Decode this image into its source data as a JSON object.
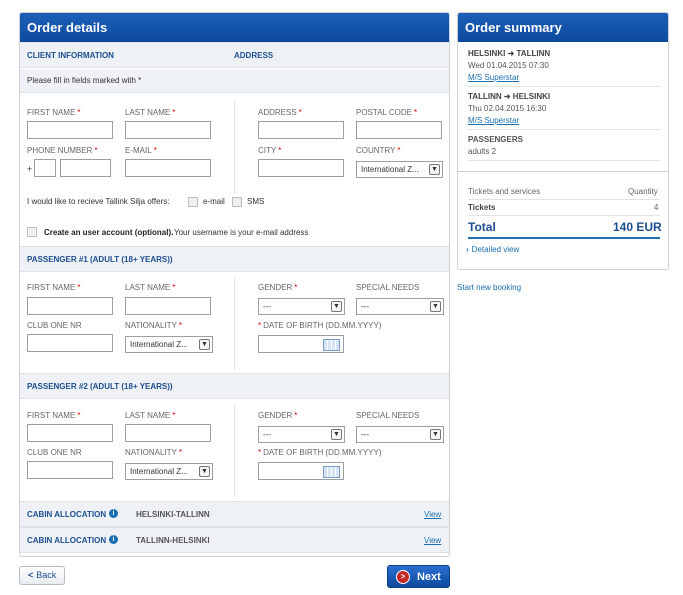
{
  "order": {
    "title": "Order details",
    "client_info_label": "CLIENT INFORMATION",
    "address_label": "ADDRESS",
    "hint": "Please fill in fields marked with *",
    "fields": {
      "first_name": "FIRST NAME",
      "last_name": "LAST NAME",
      "phone_number": "PHONE NUMBER",
      "email": "E-MAIL",
      "address": "ADDRESS",
      "postal_code": "POSTAL CODE",
      "city": "CITY",
      "country": "COUNTRY",
      "gender": "GENDER",
      "special_needs": "SPECIAL NEEDS",
      "club_one_nr": "CLUB ONE NR",
      "nationality": "NATIONALITY",
      "date_of_birth": "DATE OF BIRTH (DD.MM.YYYY)"
    },
    "req_mark": "*",
    "phone_prefix": "+",
    "country_value": "International Z...",
    "nationality_value": "International Z...",
    "dash_value": "---",
    "offers_text": "I would like to recieve Tallink Silja offers:",
    "offers_email": "e-mail",
    "offers_sms": "SMS",
    "account_bold": "Create an user account (optional).",
    "account_rest": "Your username is your e-mail address",
    "passenger1_title": "PASSENGER #1 (ADULT (18+ YEARS))",
    "passenger2_title": "PASSENGER #2 (ADULT (18+ YEARS))",
    "cabin_label": "CABIN ALLOCATION",
    "cabin1_route": "HELSINKI-TALLINN",
    "cabin2_route": "TALLINN-HELSINKI",
    "view_label": "View",
    "info_glyph": "i"
  },
  "buttons": {
    "back": "Back",
    "back_glyph": "<",
    "next": "Next",
    "next_glyph": ">"
  },
  "summary": {
    "title": "Order summary",
    "arrow": "➜",
    "trip1": {
      "from": "HELSINKI",
      "to": "TALLINN",
      "date": "Wed 01.04.2015 07:30",
      "ship": "M/S Superstar"
    },
    "trip2": {
      "from": "TALLINN",
      "to": "HELSINKI",
      "date": "Thu 02.04.2015 16:30",
      "ship": "M/S Superstar"
    },
    "passengers_label": "PASSENGERS",
    "passengers_value": "adults 2",
    "col_services": "Tickets and services",
    "col_quantity": "Quantity",
    "tickets_label": "Tickets",
    "tickets_qty": "4",
    "total_label": "Total",
    "total_value": "140 EUR",
    "detailed_view": "Detailed view",
    "detailed_glyph": "›"
  },
  "start_new_booking": "Start new booking",
  "colors": {
    "primary": "#0d4a9f",
    "link": "#1a6fb3",
    "required": "#cc0000"
  }
}
